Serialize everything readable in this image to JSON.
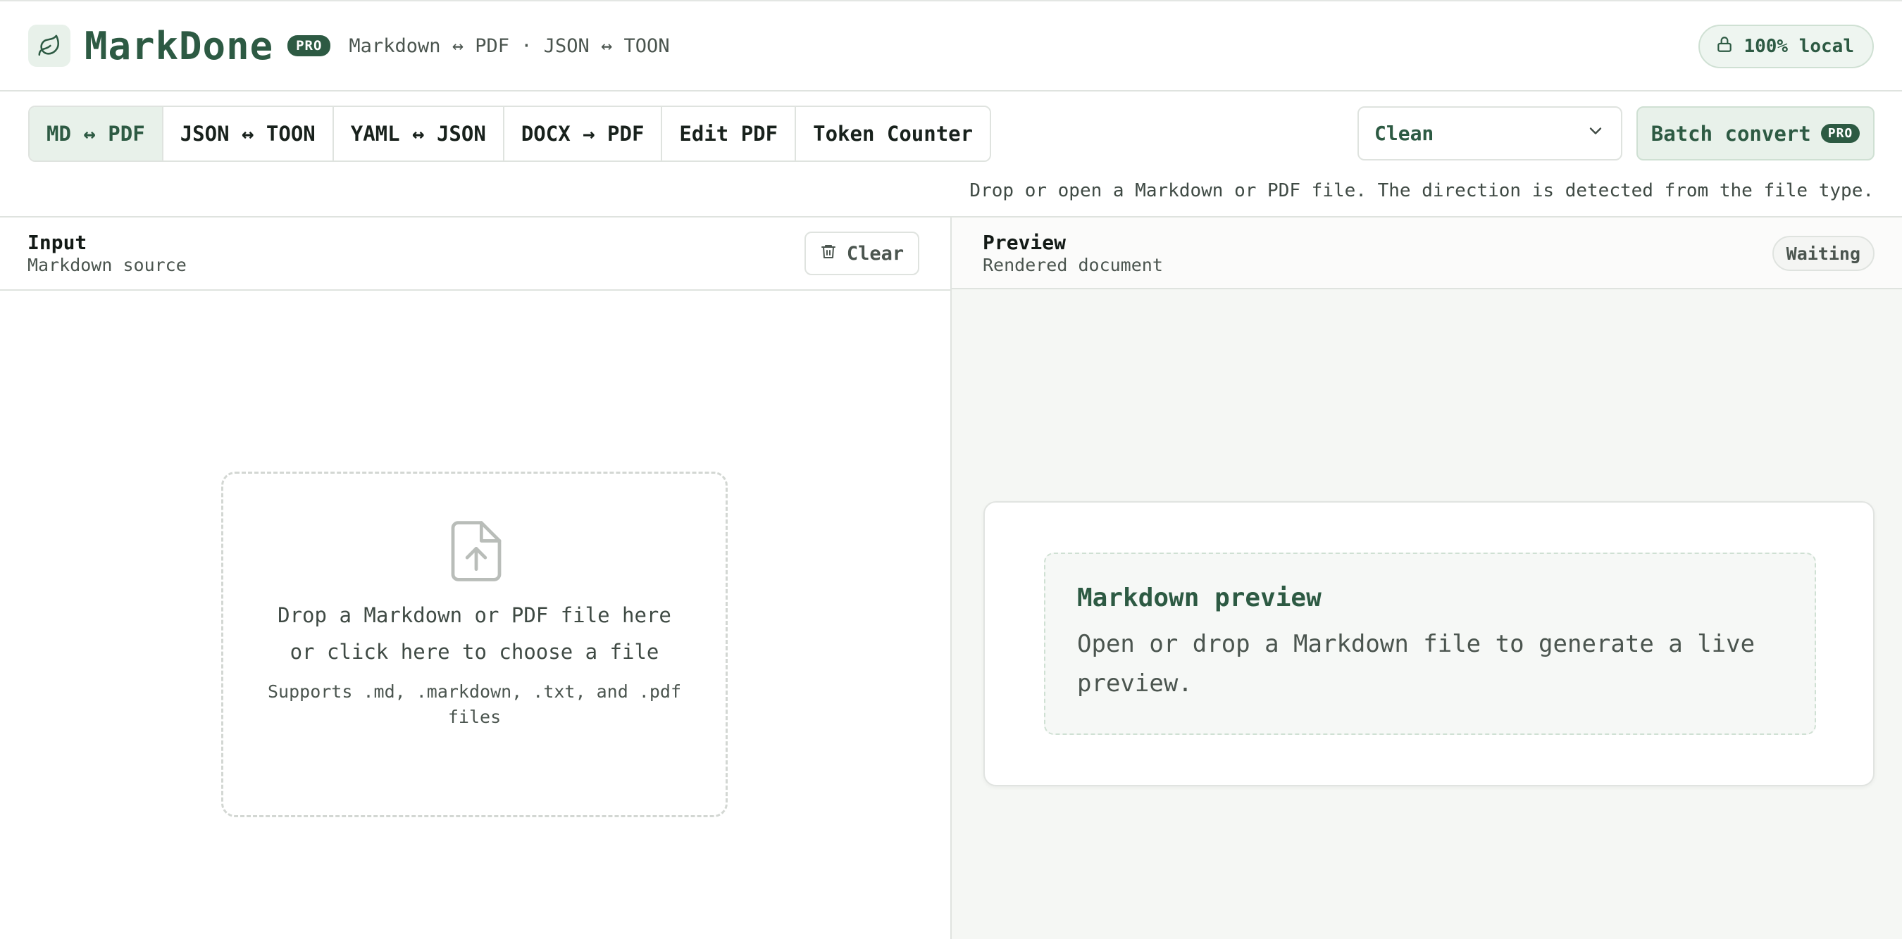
{
  "header": {
    "brand": "MarkDone",
    "pro_badge": "PRO",
    "tagline": "Markdown ↔ PDF · JSON ↔ TOON",
    "local_badge": "100% local",
    "logo_icon": "leaf-icon",
    "lock_icon": "lock-icon"
  },
  "toolbar": {
    "tabs": [
      {
        "label": "MD ↔ PDF",
        "active": true
      },
      {
        "label": "JSON ↔ TOON",
        "active": false
      },
      {
        "label": "YAML ↔ JSON",
        "active": false
      },
      {
        "label": "DOCX → PDF",
        "active": false
      },
      {
        "label": "Edit PDF",
        "active": false
      },
      {
        "label": "Token Counter",
        "active": false
      }
    ],
    "mode_select": {
      "value": "Clean",
      "icon": "chevron-down-icon"
    },
    "batch_button": {
      "label": "Batch convert",
      "badge": "PRO"
    },
    "hint": "Drop or open a Markdown or PDF file. The direction is detected from the file type."
  },
  "input_panel": {
    "title": "Input",
    "subtitle": "Markdown source",
    "clear_button": "Clear",
    "clear_icon": "trash-icon",
    "dropzone": {
      "icon": "file-upload-icon",
      "line1": "Drop a Markdown or PDF file here",
      "line2": "or click here to choose a file",
      "support": "Supports .md, .markdown, .txt, and .pdf files"
    }
  },
  "preview_panel": {
    "title": "Preview",
    "subtitle": "Rendered document",
    "status": "Waiting",
    "placeholder_title": "Markdown preview",
    "placeholder_text": "Open or drop a Markdown file to generate a live preview."
  },
  "colors": {
    "accent": "#2d5a43",
    "accent_soft": "#e8f1ea",
    "border": "#dfe3df",
    "preview_bg": "#f5f7f4"
  }
}
